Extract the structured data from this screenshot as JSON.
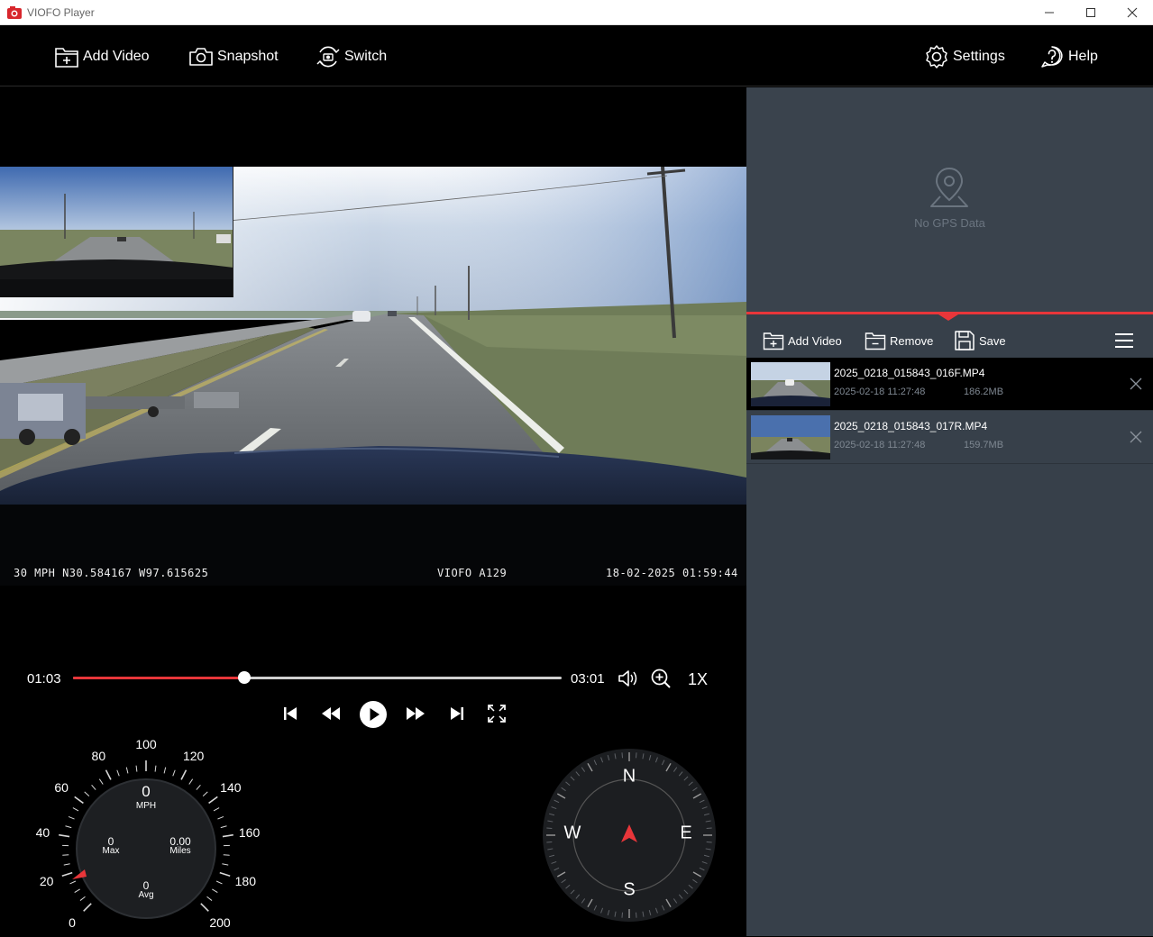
{
  "window": {
    "title": "VIOFO Player"
  },
  "toolbar": {
    "add_video": "Add Video",
    "snapshot": "Snapshot",
    "switch": "Switch",
    "settings": "Settings",
    "help": "Help"
  },
  "osd": {
    "left": "30 MPH N30.584167 W97.615625",
    "center": "VIOFO A129",
    "right": "18-02-2025 01:59:44"
  },
  "playback": {
    "current": "01:03",
    "total": "03:01",
    "progress": 0.35,
    "speed": "1X"
  },
  "gps": {
    "no_data": "No GPS Data"
  },
  "playlist": {
    "add_video": "Add Video",
    "remove": "Remove",
    "save": "Save",
    "files": [
      {
        "name": "2025_0218_015843_016F.MP4",
        "date": "2025-02-18 11:27:48",
        "size": "186.2MB"
      },
      {
        "name": "2025_0218_015843_017R.MP4",
        "date": "2025-02-18 11:27:48",
        "size": "159.7MB"
      }
    ]
  },
  "speedometer": {
    "value": "0",
    "unit": "MPH",
    "max_value": "0",
    "max_label": "Max",
    "miles_value": "0.00",
    "miles_label": "Miles",
    "avg_value": "0",
    "avg_label": "Avg",
    "scale": [
      "0",
      "20",
      "40",
      "60",
      "80",
      "100",
      "120",
      "140",
      "160",
      "180",
      "200"
    ]
  },
  "compass": {
    "n": "N",
    "e": "E",
    "s": "S",
    "w": "W"
  }
}
